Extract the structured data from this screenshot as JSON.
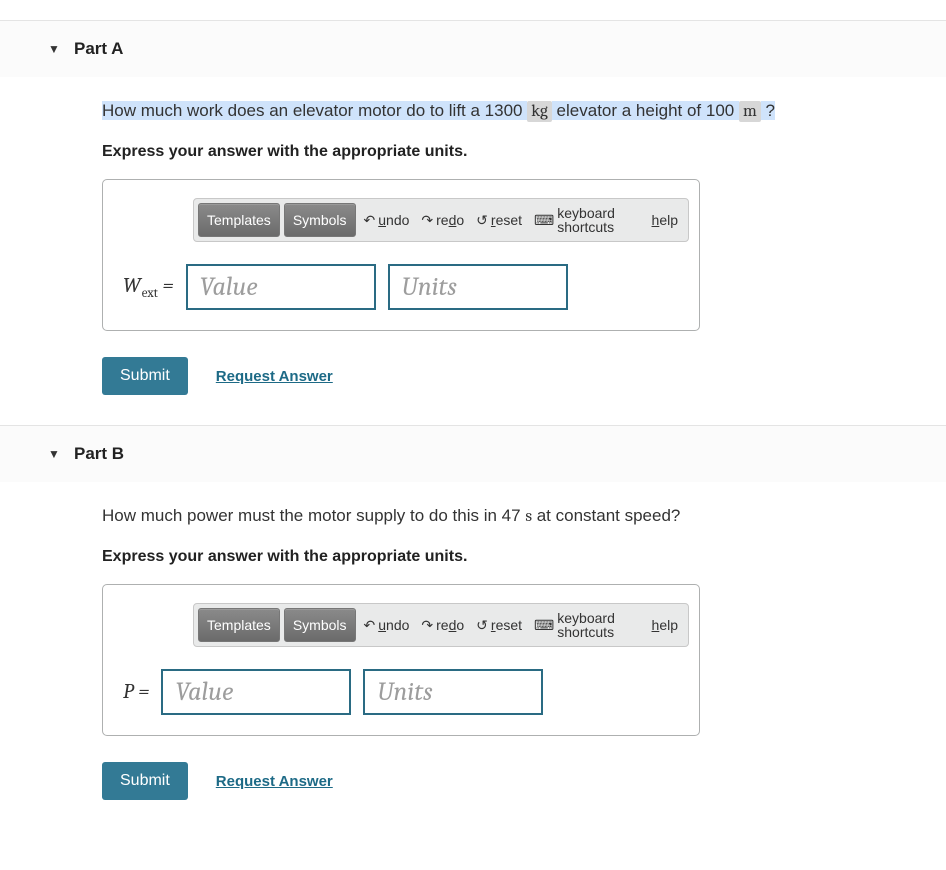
{
  "toolbar": {
    "templates": "Templates",
    "symbols": "Symbols",
    "undo": "undo",
    "redo": "redo",
    "reset": "reset",
    "keyboard": "keyboard shortcuts",
    "help": "help"
  },
  "fields": {
    "value_placeholder": "Value",
    "units_placeholder": "Units"
  },
  "actions": {
    "submit": "Submit",
    "request": "Request Answer"
  },
  "partA": {
    "title": "Part A",
    "question_prefix": "How much work does an elevator motor do to lift a 1300 ",
    "unit1": "kg",
    "question_mid": " elevator a height of 100 ",
    "unit2": "m",
    "question_suffix": " ?",
    "instruction": "Express your answer with the appropriate units.",
    "var_main": "W",
    "var_sub": "ext",
    "eq": " ="
  },
  "partB": {
    "title": "Part B",
    "question_prefix": "How much power must the motor supply to do this in 47 ",
    "unit1": "s",
    "question_suffix": " at constant speed?",
    "instruction": "Express your answer with the appropriate units.",
    "var_main": "P",
    "eq": " ="
  }
}
